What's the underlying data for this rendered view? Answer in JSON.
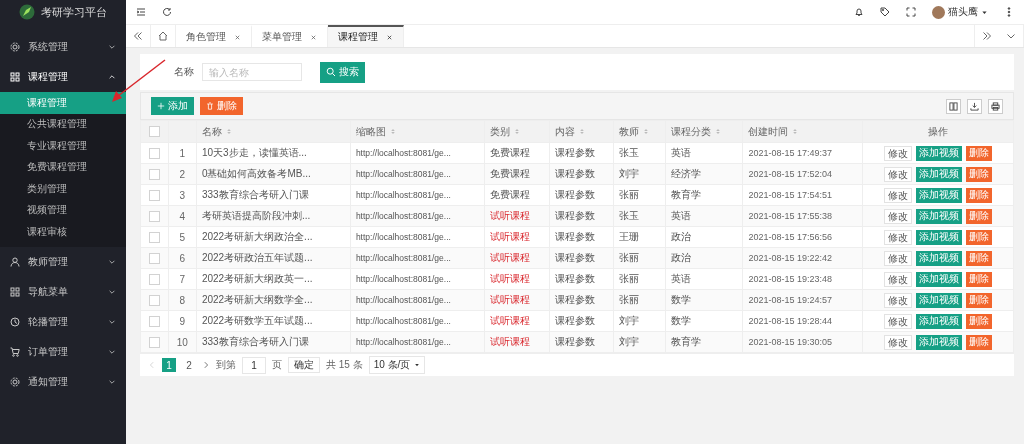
{
  "app": {
    "title": "考研学习平台"
  },
  "sidebar": {
    "items": [
      {
        "label": "系统管理",
        "expanded": false
      },
      {
        "label": "课程管理",
        "expanded": true,
        "children": [
          {
            "label": "课程管理",
            "selected": true
          },
          {
            "label": "公共课程管理",
            "selected": false
          },
          {
            "label": "专业课程管理",
            "selected": false
          },
          {
            "label": "免费课程管理",
            "selected": false
          },
          {
            "label": "类别管理",
            "selected": false
          },
          {
            "label": "视频管理",
            "selected": false
          },
          {
            "label": "课程审核",
            "selected": false
          }
        ]
      },
      {
        "label": "教师管理",
        "expanded": false
      },
      {
        "label": "导航菜单",
        "expanded": false
      },
      {
        "label": "轮播管理",
        "expanded": false
      },
      {
        "label": "订单管理",
        "expanded": false
      },
      {
        "label": "通知管理",
        "expanded": false
      }
    ]
  },
  "header": {
    "user": "猫头鹰"
  },
  "tabs": [
    {
      "label": "角色管理",
      "selected": false
    },
    {
      "label": "菜单管理",
      "selected": false
    },
    {
      "label": "课程管理",
      "selected": true
    }
  ],
  "search": {
    "label": "名称",
    "placeholder": "输入名称",
    "button": "搜索"
  },
  "toolbar": {
    "add": "添加",
    "delete": "删除"
  },
  "table": {
    "header_checked": false,
    "columns": [
      {
        "label": "名称",
        "sortable": true
      },
      {
        "label": "缩略图",
        "sortable": true
      },
      {
        "label": "类别",
        "sortable": true
      },
      {
        "label": "内容",
        "sortable": true
      },
      {
        "label": "教师",
        "sortable": true
      },
      {
        "label": "课程分类",
        "sortable": true
      },
      {
        "label": "创建时间",
        "sortable": true
      },
      {
        "label": "操作",
        "sortable": false
      }
    ],
    "rows": [
      {
        "checked": false,
        "index": "1",
        "name": "10天3步走，读懂英语...",
        "thumbnail": "http://localhost:8081/ge...",
        "category": "免费课程",
        "highlighted": false,
        "content": "课程参数",
        "teacher": "张玉",
        "subject": "英语",
        "created": "2021-08-15 17:49:37",
        "actions": [
          {
            "label": "修改",
            "kind": "plain"
          },
          {
            "label": "添加视频",
            "kind": "primary"
          },
          {
            "label": "删除",
            "kind": "danger"
          }
        ]
      },
      {
        "checked": false,
        "index": "2",
        "name": "0基础如何高效备考MB...",
        "thumbnail": "http://localhost:8081/ge...",
        "category": "免费课程",
        "highlighted": false,
        "content": "课程参数",
        "teacher": "刘宇",
        "subject": "经济学",
        "created": "2021-08-15 17:52:04",
        "actions": [
          {
            "label": "修改",
            "kind": "plain"
          },
          {
            "label": "添加视频",
            "kind": "primary"
          },
          {
            "label": "删除",
            "kind": "danger"
          }
        ]
      },
      {
        "checked": false,
        "index": "3",
        "name": "333教育综合考研入门课",
        "thumbnail": "http://localhost:8081/ge...",
        "category": "免费课程",
        "highlighted": false,
        "content": "课程参数",
        "teacher": "张丽",
        "subject": "教育学",
        "created": "2021-08-15 17:54:51",
        "actions": [
          {
            "label": "修改",
            "kind": "plain"
          },
          {
            "label": "添加视频",
            "kind": "primary"
          },
          {
            "label": "删除",
            "kind": "danger"
          }
        ]
      },
      {
        "checked": false,
        "index": "4",
        "name": "考研英语提高阶段冲刺...",
        "thumbnail": "http://localhost:8081/ge...",
        "category": "试听课程",
        "highlighted": true,
        "content": "课程参数",
        "teacher": "张玉",
        "subject": "英语",
        "created": "2021-08-15 17:55:38",
        "actions": [
          {
            "label": "修改",
            "kind": "plain"
          },
          {
            "label": "添加视频",
            "kind": "primary"
          },
          {
            "label": "删除",
            "kind": "danger"
          }
        ]
      },
      {
        "checked": false,
        "index": "5",
        "name": "2022考研新大纲政治全...",
        "thumbnail": "http://localhost:8081/ge...",
        "category": "试听课程",
        "highlighted": true,
        "content": "课程参数",
        "teacher": "王珊",
        "subject": "政治",
        "created": "2021-08-15 17:56:56",
        "actions": [
          {
            "label": "修改",
            "kind": "plain"
          },
          {
            "label": "添加视频",
            "kind": "primary"
          },
          {
            "label": "删除",
            "kind": "danger"
          }
        ]
      },
      {
        "checked": false,
        "index": "6",
        "name": "2022考研政治五年试题...",
        "thumbnail": "http://localhost:8081/ge...",
        "category": "试听课程",
        "highlighted": true,
        "content": "课程参数",
        "teacher": "张丽",
        "subject": "政治",
        "created": "2021-08-15 19:22:42",
        "actions": [
          {
            "label": "修改",
            "kind": "plain"
          },
          {
            "label": "添加视频",
            "kind": "primary"
          },
          {
            "label": "删除",
            "kind": "danger"
          }
        ]
      },
      {
        "checked": false,
        "index": "7",
        "name": "2022考研新大纲政英一...",
        "thumbnail": "http://localhost:8081/ge...",
        "category": "试听课程",
        "highlighted": true,
        "content": "课程参数",
        "teacher": "张丽",
        "subject": "英语",
        "created": "2021-08-15 19:23:48",
        "actions": [
          {
            "label": "修改",
            "kind": "plain"
          },
          {
            "label": "添加视频",
            "kind": "primary"
          },
          {
            "label": "删除",
            "kind": "danger"
          }
        ]
      },
      {
        "checked": false,
        "index": "8",
        "name": "2022考研新大纲数学全...",
        "thumbnail": "http://localhost:8081/ge...",
        "category": "试听课程",
        "highlighted": true,
        "content": "课程参数",
        "teacher": "张丽",
        "subject": "数学",
        "created": "2021-08-15 19:24:57",
        "actions": [
          {
            "label": "修改",
            "kind": "plain"
          },
          {
            "label": "添加视频",
            "kind": "primary"
          },
          {
            "label": "删除",
            "kind": "danger"
          }
        ]
      },
      {
        "checked": false,
        "index": "9",
        "name": "2022考研数学五年试题...",
        "thumbnail": "http://localhost:8081/ge...",
        "category": "试听课程",
        "highlighted": true,
        "content": "课程参数",
        "teacher": "刘宇",
        "subject": "数学",
        "created": "2021-08-15 19:28:44",
        "actions": [
          {
            "label": "修改",
            "kind": "plain"
          },
          {
            "label": "添加视频",
            "kind": "primary"
          },
          {
            "label": "删除",
            "kind": "danger"
          }
        ]
      },
      {
        "checked": false,
        "index": "10",
        "name": "333教育综合考研入门课",
        "thumbnail": "http://localhost:8081/ge...",
        "category": "试听课程",
        "highlighted": true,
        "content": "课程参数",
        "teacher": "刘宇",
        "subject": "教育学",
        "created": "2021-08-15 19:30:05",
        "actions": [
          {
            "label": "修改",
            "kind": "plain"
          },
          {
            "label": "添加视频",
            "kind": "primary"
          },
          {
            "label": "删除",
            "kind": "danger"
          }
        ]
      }
    ]
  },
  "pagination": {
    "pages": [
      {
        "label": "1",
        "selected": true
      },
      {
        "label": "2",
        "selected": false
      }
    ],
    "goto_label": "到第",
    "page_input": "1",
    "page_unit": "页",
    "confirm": "确定",
    "total": "共 15 条",
    "page_size": "10 条/页"
  }
}
